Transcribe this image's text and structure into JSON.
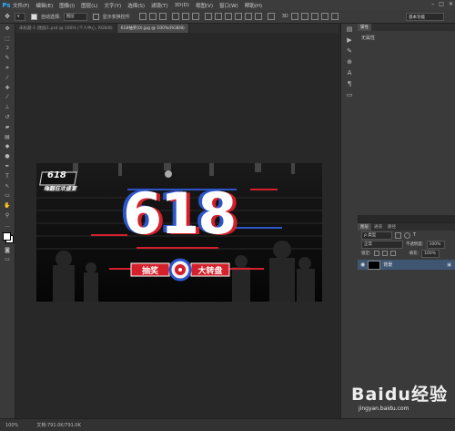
{
  "app": {
    "logo": "Ps"
  },
  "menu": [
    "文件(F)",
    "编辑(E)",
    "图像(I)",
    "图层(L)",
    "文字(Y)",
    "选择(S)",
    "滤镜(T)",
    "3D(D)",
    "视图(V)",
    "窗口(W)",
    "帮助(H)"
  ],
  "window_buttons": [
    "–",
    "□",
    "✕"
  ],
  "options": {
    "auto_select_label": "自动选择:",
    "auto_select_value": "图层",
    "show_transform_label": "显示变换控件",
    "workspace": "基本功能"
  },
  "tabs": [
    "未标题-1 (图层1.psd @ 100% (个人中心, RGB/8)",
    "618抽奖(0).jpg @ 100%(RGB/8)"
  ],
  "banner": {
    "badge_number": "618",
    "badge_text": "嗨翻狂欢盛宴",
    "big_number": "618",
    "left_label": "抽奖",
    "right_label": "大转盘"
  },
  "properties": {
    "tab": "属性",
    "content": "无属性"
  },
  "layers": {
    "tabs": [
      "图层",
      "通道",
      "路径"
    ],
    "filter": "ρ 类型",
    "blend": "正常",
    "opacity_label": "不透明度:",
    "opacity": "100%",
    "lock_label": "锁定:",
    "fill_label": "填充:",
    "fill": "100%",
    "layer_name": "背景"
  },
  "status": {
    "zoom": "100%",
    "doc": "文档:791.0K/791.0K"
  },
  "watermark": {
    "brand": "Baidu经验",
    "url": "jingyan.baidu.com"
  }
}
